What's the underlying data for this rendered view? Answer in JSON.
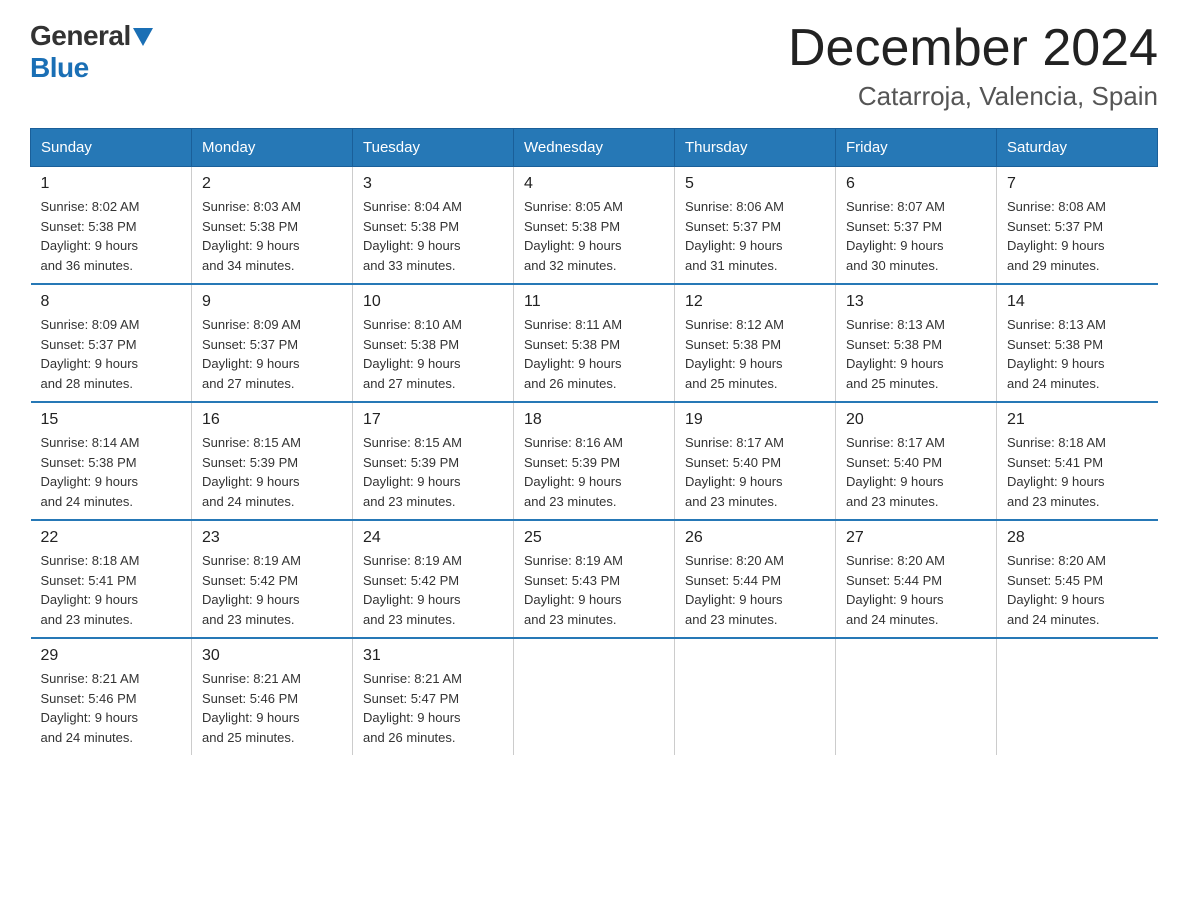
{
  "header": {
    "logo_general": "General",
    "logo_blue": "Blue",
    "title": "December 2024",
    "subtitle": "Catarroja, Valencia, Spain"
  },
  "days_of_week": [
    "Sunday",
    "Monday",
    "Tuesday",
    "Wednesday",
    "Thursday",
    "Friday",
    "Saturday"
  ],
  "weeks": [
    [
      {
        "day": "1",
        "sunrise": "8:02 AM",
        "sunset": "5:38 PM",
        "daylight": "9 hours and 36 minutes."
      },
      {
        "day": "2",
        "sunrise": "8:03 AM",
        "sunset": "5:38 PM",
        "daylight": "9 hours and 34 minutes."
      },
      {
        "day": "3",
        "sunrise": "8:04 AM",
        "sunset": "5:38 PM",
        "daylight": "9 hours and 33 minutes."
      },
      {
        "day": "4",
        "sunrise": "8:05 AM",
        "sunset": "5:38 PM",
        "daylight": "9 hours and 32 minutes."
      },
      {
        "day": "5",
        "sunrise": "8:06 AM",
        "sunset": "5:37 PM",
        "daylight": "9 hours and 31 minutes."
      },
      {
        "day": "6",
        "sunrise": "8:07 AM",
        "sunset": "5:37 PM",
        "daylight": "9 hours and 30 minutes."
      },
      {
        "day": "7",
        "sunrise": "8:08 AM",
        "sunset": "5:37 PM",
        "daylight": "9 hours and 29 minutes."
      }
    ],
    [
      {
        "day": "8",
        "sunrise": "8:09 AM",
        "sunset": "5:37 PM",
        "daylight": "9 hours and 28 minutes."
      },
      {
        "day": "9",
        "sunrise": "8:09 AM",
        "sunset": "5:37 PM",
        "daylight": "9 hours and 27 minutes."
      },
      {
        "day": "10",
        "sunrise": "8:10 AM",
        "sunset": "5:38 PM",
        "daylight": "9 hours and 27 minutes."
      },
      {
        "day": "11",
        "sunrise": "8:11 AM",
        "sunset": "5:38 PM",
        "daylight": "9 hours and 26 minutes."
      },
      {
        "day": "12",
        "sunrise": "8:12 AM",
        "sunset": "5:38 PM",
        "daylight": "9 hours and 25 minutes."
      },
      {
        "day": "13",
        "sunrise": "8:13 AM",
        "sunset": "5:38 PM",
        "daylight": "9 hours and 25 minutes."
      },
      {
        "day": "14",
        "sunrise": "8:13 AM",
        "sunset": "5:38 PM",
        "daylight": "9 hours and 24 minutes."
      }
    ],
    [
      {
        "day": "15",
        "sunrise": "8:14 AM",
        "sunset": "5:38 PM",
        "daylight": "9 hours and 24 minutes."
      },
      {
        "day": "16",
        "sunrise": "8:15 AM",
        "sunset": "5:39 PM",
        "daylight": "9 hours and 24 minutes."
      },
      {
        "day": "17",
        "sunrise": "8:15 AM",
        "sunset": "5:39 PM",
        "daylight": "9 hours and 23 minutes."
      },
      {
        "day": "18",
        "sunrise": "8:16 AM",
        "sunset": "5:39 PM",
        "daylight": "9 hours and 23 minutes."
      },
      {
        "day": "19",
        "sunrise": "8:17 AM",
        "sunset": "5:40 PM",
        "daylight": "9 hours and 23 minutes."
      },
      {
        "day": "20",
        "sunrise": "8:17 AM",
        "sunset": "5:40 PM",
        "daylight": "9 hours and 23 minutes."
      },
      {
        "day": "21",
        "sunrise": "8:18 AM",
        "sunset": "5:41 PM",
        "daylight": "9 hours and 23 minutes."
      }
    ],
    [
      {
        "day": "22",
        "sunrise": "8:18 AM",
        "sunset": "5:41 PM",
        "daylight": "9 hours and 23 minutes."
      },
      {
        "day": "23",
        "sunrise": "8:19 AM",
        "sunset": "5:42 PM",
        "daylight": "9 hours and 23 minutes."
      },
      {
        "day": "24",
        "sunrise": "8:19 AM",
        "sunset": "5:42 PM",
        "daylight": "9 hours and 23 minutes."
      },
      {
        "day": "25",
        "sunrise": "8:19 AM",
        "sunset": "5:43 PM",
        "daylight": "9 hours and 23 minutes."
      },
      {
        "day": "26",
        "sunrise": "8:20 AM",
        "sunset": "5:44 PM",
        "daylight": "9 hours and 23 minutes."
      },
      {
        "day": "27",
        "sunrise": "8:20 AM",
        "sunset": "5:44 PM",
        "daylight": "9 hours and 24 minutes."
      },
      {
        "day": "28",
        "sunrise": "8:20 AM",
        "sunset": "5:45 PM",
        "daylight": "9 hours and 24 minutes."
      }
    ],
    [
      {
        "day": "29",
        "sunrise": "8:21 AM",
        "sunset": "5:46 PM",
        "daylight": "9 hours and 24 minutes."
      },
      {
        "day": "30",
        "sunrise": "8:21 AM",
        "sunset": "5:46 PM",
        "daylight": "9 hours and 25 minutes."
      },
      {
        "day": "31",
        "sunrise": "8:21 AM",
        "sunset": "5:47 PM",
        "daylight": "9 hours and 26 minutes."
      },
      null,
      null,
      null,
      null
    ]
  ],
  "labels": {
    "sunrise": "Sunrise:",
    "sunset": "Sunset:",
    "daylight": "Daylight:"
  }
}
